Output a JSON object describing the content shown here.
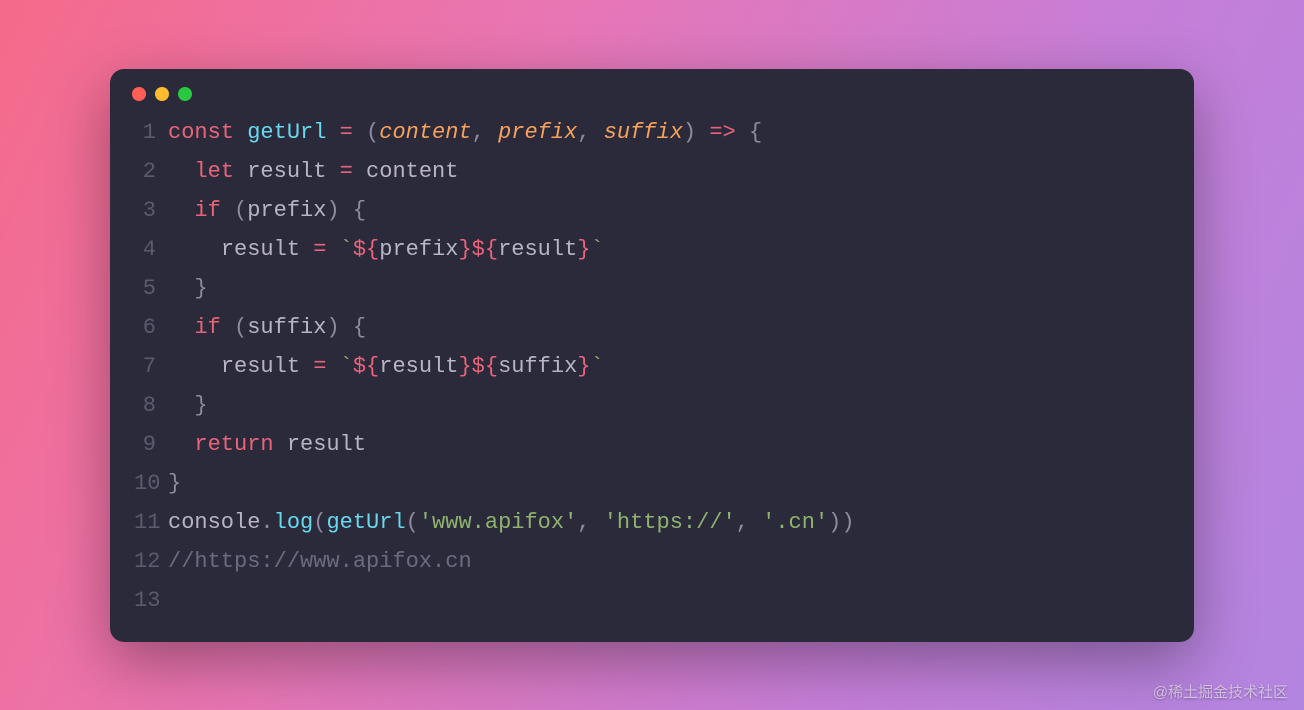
{
  "window": {
    "buttons": [
      "close",
      "minimize",
      "zoom"
    ]
  },
  "code": {
    "lines": [
      {
        "num": "1",
        "tokens": [
          {
            "t": "const ",
            "c": "tok-keyword"
          },
          {
            "t": "getUrl",
            "c": "tok-funcname"
          },
          {
            "t": " ",
            "c": "tok-ident"
          },
          {
            "t": "=",
            "c": "tok-operator"
          },
          {
            "t": " ",
            "c": "tok-ident"
          },
          {
            "t": "(",
            "c": "tok-punct"
          },
          {
            "t": "content",
            "c": "tok-param"
          },
          {
            "t": ", ",
            "c": "tok-punct"
          },
          {
            "t": "prefix",
            "c": "tok-param"
          },
          {
            "t": ", ",
            "c": "tok-punct"
          },
          {
            "t": "suffix",
            "c": "tok-param"
          },
          {
            "t": ")",
            "c": "tok-punct"
          },
          {
            "t": " ",
            "c": "tok-ident"
          },
          {
            "t": "=>",
            "c": "tok-operator"
          },
          {
            "t": " ",
            "c": "tok-ident"
          },
          {
            "t": "{",
            "c": "tok-punct"
          }
        ]
      },
      {
        "num": "2",
        "tokens": [
          {
            "t": "  ",
            "c": "tok-ident"
          },
          {
            "t": "let ",
            "c": "tok-keyword"
          },
          {
            "t": "result",
            "c": "tok-ident"
          },
          {
            "t": " ",
            "c": "tok-ident"
          },
          {
            "t": "=",
            "c": "tok-operator"
          },
          {
            "t": " ",
            "c": "tok-ident"
          },
          {
            "t": "content",
            "c": "tok-ident"
          }
        ]
      },
      {
        "num": "3",
        "tokens": [
          {
            "t": "  ",
            "c": "tok-ident"
          },
          {
            "t": "if ",
            "c": "tok-keyword"
          },
          {
            "t": "(",
            "c": "tok-punct"
          },
          {
            "t": "prefix",
            "c": "tok-ident"
          },
          {
            "t": ")",
            "c": "tok-punct"
          },
          {
            "t": " ",
            "c": "tok-ident"
          },
          {
            "t": "{",
            "c": "tok-punct"
          }
        ]
      },
      {
        "num": "4",
        "tokens": [
          {
            "t": "    ",
            "c": "tok-ident"
          },
          {
            "t": "result",
            "c": "tok-ident"
          },
          {
            "t": " ",
            "c": "tok-ident"
          },
          {
            "t": "=",
            "c": "tok-operator"
          },
          {
            "t": " ",
            "c": "tok-ident"
          },
          {
            "t": "`",
            "c": "tok-tmpl"
          },
          {
            "t": "${",
            "c": "tok-interp"
          },
          {
            "t": "prefix",
            "c": "tok-interp-id"
          },
          {
            "t": "}",
            "c": "tok-interp"
          },
          {
            "t": "${",
            "c": "tok-interp"
          },
          {
            "t": "result",
            "c": "tok-interp-id"
          },
          {
            "t": "}",
            "c": "tok-interp"
          },
          {
            "t": "`",
            "c": "tok-tmpl"
          }
        ]
      },
      {
        "num": "5",
        "tokens": [
          {
            "t": "  ",
            "c": "tok-ident"
          },
          {
            "t": "}",
            "c": "tok-punct"
          }
        ]
      },
      {
        "num": "6",
        "tokens": [
          {
            "t": "  ",
            "c": "tok-ident"
          },
          {
            "t": "if ",
            "c": "tok-keyword"
          },
          {
            "t": "(",
            "c": "tok-punct"
          },
          {
            "t": "suffix",
            "c": "tok-ident"
          },
          {
            "t": ")",
            "c": "tok-punct"
          },
          {
            "t": " ",
            "c": "tok-ident"
          },
          {
            "t": "{",
            "c": "tok-punct"
          }
        ]
      },
      {
        "num": "7",
        "tokens": [
          {
            "t": "    ",
            "c": "tok-ident"
          },
          {
            "t": "result",
            "c": "tok-ident"
          },
          {
            "t": " ",
            "c": "tok-ident"
          },
          {
            "t": "=",
            "c": "tok-operator"
          },
          {
            "t": " ",
            "c": "tok-ident"
          },
          {
            "t": "`",
            "c": "tok-tmpl"
          },
          {
            "t": "${",
            "c": "tok-interp"
          },
          {
            "t": "result",
            "c": "tok-interp-id"
          },
          {
            "t": "}",
            "c": "tok-interp"
          },
          {
            "t": "${",
            "c": "tok-interp"
          },
          {
            "t": "suffix",
            "c": "tok-interp-id"
          },
          {
            "t": "}",
            "c": "tok-interp"
          },
          {
            "t": "`",
            "c": "tok-tmpl"
          }
        ]
      },
      {
        "num": "8",
        "tokens": [
          {
            "t": "  ",
            "c": "tok-ident"
          },
          {
            "t": "}",
            "c": "tok-punct"
          }
        ]
      },
      {
        "num": "9",
        "tokens": [
          {
            "t": "  ",
            "c": "tok-ident"
          },
          {
            "t": "return ",
            "c": "tok-keyword"
          },
          {
            "t": "result",
            "c": "tok-ident"
          }
        ]
      },
      {
        "num": "10",
        "tokens": [
          {
            "t": "}",
            "c": "tok-punct"
          }
        ]
      },
      {
        "num": "11",
        "tokens": [
          {
            "t": "console",
            "c": "tok-builtin"
          },
          {
            "t": ".",
            "c": "tok-punct"
          },
          {
            "t": "log",
            "c": "tok-method"
          },
          {
            "t": "(",
            "c": "tok-punct"
          },
          {
            "t": "getUrl",
            "c": "tok-funcname"
          },
          {
            "t": "(",
            "c": "tok-punct"
          },
          {
            "t": "'www.apifox'",
            "c": "tok-string"
          },
          {
            "t": ", ",
            "c": "tok-punct"
          },
          {
            "t": "'https://'",
            "c": "tok-string"
          },
          {
            "t": ", ",
            "c": "tok-punct"
          },
          {
            "t": "'.cn'",
            "c": "tok-string"
          },
          {
            "t": ")",
            "c": "tok-punct"
          },
          {
            "t": ")",
            "c": "tok-punct"
          }
        ]
      },
      {
        "num": "12",
        "tokens": [
          {
            "t": "//https://www.apifox.cn",
            "c": "tok-comment"
          }
        ]
      },
      {
        "num": "13",
        "tokens": [
          {
            "t": "",
            "c": "tok-ident"
          }
        ]
      }
    ]
  },
  "watermark": "@稀土掘金技术社区"
}
